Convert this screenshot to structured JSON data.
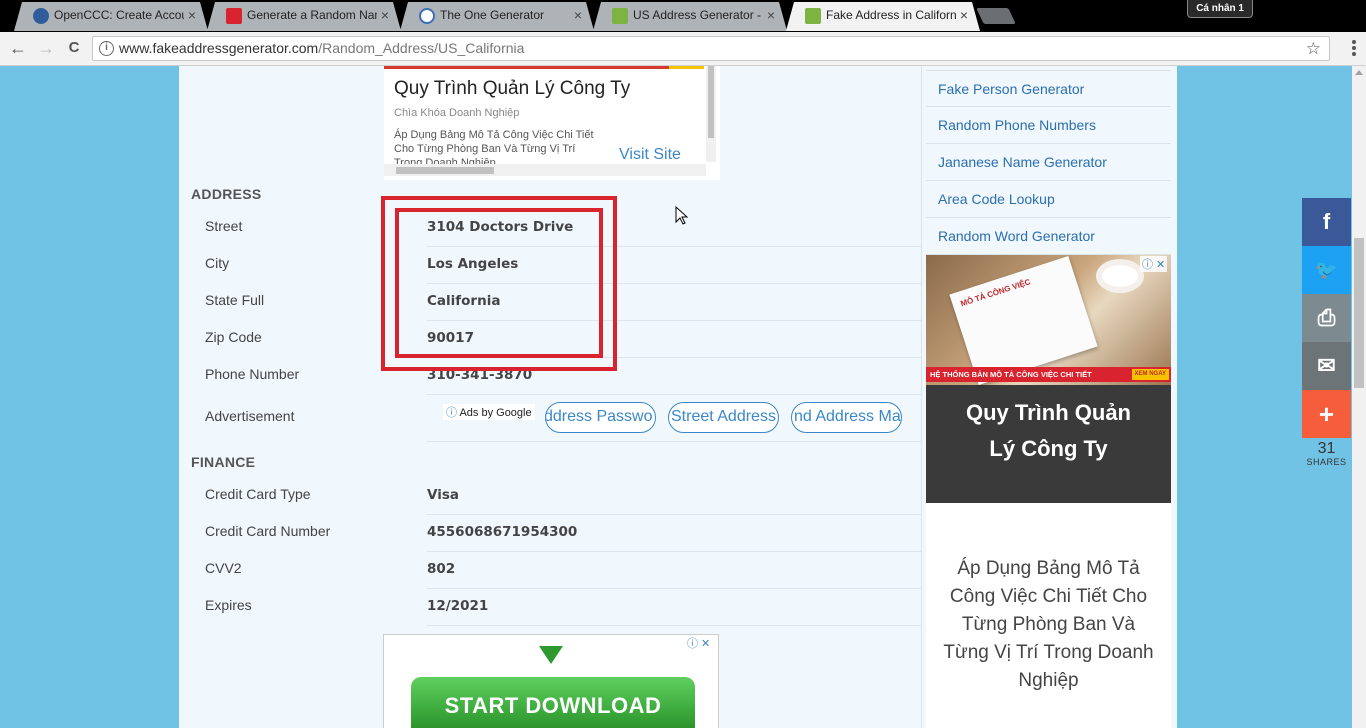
{
  "browser": {
    "tabs": [
      {
        "title": "OpenCCC: Create Accou",
        "icon_color": "#2f5d9b"
      },
      {
        "title": "Generate a Random Nam",
        "icon_color": "#d9232e"
      },
      {
        "title": "The One Generator",
        "icon_color": "#3b6fb6"
      },
      {
        "title": "US Address Generator - F",
        "icon_color": "#7cb342"
      },
      {
        "title": "Fake Address in Californi",
        "icon_color": "#7cb342"
      }
    ],
    "tab_close": "×",
    "profile": "Cá nhân 1",
    "back": "←",
    "forward": "→",
    "reload": "C",
    "url_domain": "www.fakeaddressgenerator.com",
    "url_path": "/Random_Address/US_California",
    "info_icon": "i",
    "bookmark_star": "☆"
  },
  "ad_top": {
    "title": "Quy Trình Quản Lý Công Ty",
    "subtitle": "Chìa Khóa Doanh Nghiệp",
    "desc": "Áp Dụng Bảng Mô Tả Công Việc Chi Tiết Cho Từng Phòng Ban Và Từng Vị Trí Trong Doanh Nghiệp",
    "cta": "Visit Site"
  },
  "address": {
    "section": "ADDRESS",
    "rows": [
      {
        "label": "Street",
        "value": "3104 Doctors Drive"
      },
      {
        "label": "City",
        "value": "Los Angeles"
      },
      {
        "label": "State Full",
        "value": "California"
      },
      {
        "label": "Zip Code",
        "value": "90017"
      },
      {
        "label": "Phone Number",
        "value": "310-341-3870"
      }
    ],
    "advertisement_label": "Advertisement",
    "ads_by": "Ads by Google",
    "ad_links": [
      "ddress Passwo",
      "Street Address",
      "nd Address Ma"
    ]
  },
  "finance": {
    "section": "FINANCE",
    "rows": [
      {
        "label": "Credit Card Type",
        "value": "Visa"
      },
      {
        "label": "Credit Card Number",
        "value": "4556068671954300"
      },
      {
        "label": "CVV2",
        "value": "802"
      },
      {
        "label": "Expires",
        "value": "12/2021"
      }
    ]
  },
  "ad_bottom": {
    "button": "START DOWNLOAD",
    "choices": "ⓘ ✕"
  },
  "sidebar": {
    "links": [
      "Fake Person Generator",
      "Random Phone Numbers",
      "Jananese Name Generator",
      "Area Code Lookup",
      "Random Word Generator"
    ],
    "ad": {
      "paper_title": "MÔ TẢ CÔNG VIỆC",
      "strip": "HỆ THỐNG BẢN MÔ TẢ CÔNG VIỆC CHI TIẾT",
      "strip_button": "XEM NGAY",
      "heading": "Quy Trình Quản Lý Công Ty",
      "body": "Áp Dụng Bảng Mô Tả Công Việc Chi Tiết Cho Từng Phòng Ban Và Từng Vị Trí Trong Doanh Nghiệp",
      "choices": "ⓘ ✕"
    }
  },
  "share": {
    "facebook": "f",
    "twitter": "🐦",
    "print": "⎙",
    "email": "✉",
    "more": "+",
    "count": "31",
    "label": "SHARES",
    "colors": {
      "facebook": "#3b5998",
      "twitter": "#1da1f2",
      "print": "#7d8b91",
      "email": "#6d7478",
      "more": "#f65e3b"
    }
  }
}
